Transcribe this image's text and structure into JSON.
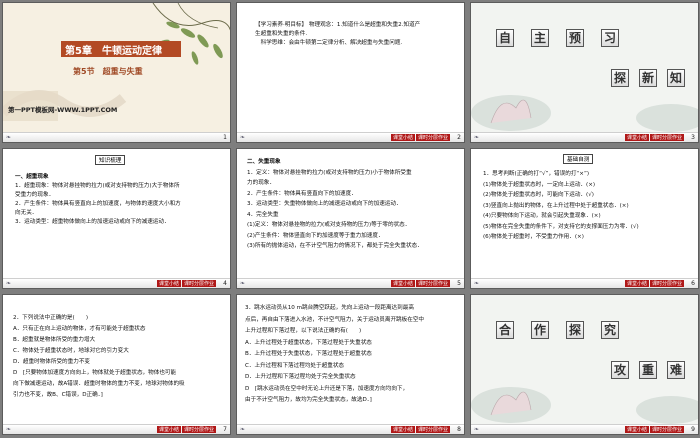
{
  "slides": [
    {
      "num": "1",
      "chapter": "第5章　牛顿运动定律",
      "section": "第5节　超重与失重",
      "site": "第一PPT模板网-WWW.1PPT.COM"
    },
    {
      "num": "2",
      "lines": [
        "【学习素养·明目标】 物理观念：1.知道什么是超重和失重2.知道产",
        "生超重和失重的条件.",
        "　科学思维：会由牛顿第二定律分析、解决超重与失重问题."
      ]
    },
    {
      "num": "3",
      "chars1": [
        "自",
        "主",
        "预",
        "习"
      ],
      "chars2": [
        "探",
        "新",
        "知"
      ]
    },
    {
      "num": "4",
      "heading": "知识梳理",
      "lines": [
        "一、超重现象",
        "1．超重现象：物体对悬挂物的拉力(或对支持物的压力)大于物体所",
        "受重力的现象．",
        "2．产生条件：物体具有竖直向上的加速度，与物体的速度大小和方",
        "向无关．",
        "3．运动类型：超重物体做向上的加速运动或向下的减速运动．"
      ]
    },
    {
      "num": "5",
      "lines": [
        "二、失重现象",
        "1．定义：物体对悬挂物的拉力(或对支持物的压力)小于物体所受重",
        "力的现象．",
        "2．产生条件：物体具有竖直向下的加速度．",
        "3．运动类型：失重物体做向上的减速运动或向下的加速运动．",
        "4．完全失重",
        "(1)定义：物体对悬挂物的拉力(或对支持物的压力)等于零的状态．",
        "(2)产生条件：物体竖直向下的加速度等于重力加速度．",
        "(3)所有的抛体运动，在不计空气阻力的情况下，都处于完全失重状态．"
      ]
    },
    {
      "num": "6",
      "heading": "基础自测",
      "lines": [
        "1．思考判断(正确的打“√”，错误的打“×”)",
        "(1)物体处于超重状态时，一定向上运动．(×)",
        "(2)物体处于超重状态时，可能向下运动．(√)",
        "(3)竖直向上抛出的物体，在上升过程中处于超重状态．(×)",
        "(4)只要物体向下运动，就会引起失重现象．(×)",
        "(5)物体在完全失重的条件下，对支持它的支撑面压力为零．(√)",
        "(6)物体处于超重时，不受重力作用．(×)"
      ]
    },
    {
      "num": "7",
      "lines": [
        "2．下列说法中正确的是(　　)",
        "A．只有正在向上运动的物体，才有可能处于超重状态",
        "B．超重就是物体所受的重力增大",
        "C．物体处于超重状态时，地球对它的引力变大",
        "D．超重时物体所受的重力不变",
        "D　[只要物体加速度方向向上，物体就处于超重状态，物体也可能",
        "向下做减速运动，故A错误．超重时物体的重力不变，地球对物体的吸",
        "引力也不变，故B、C错误，D正确．]"
      ]
    },
    {
      "num": "8",
      "lines": [
        "3．跳水运动员从10 m跳台腾空跃起，先向上运动一段距离达到最高",
        "点后，再自由下落进入水池，不计空气阻力，关于运动员离开跳板在空中",
        "上升过程和下落过程，以下说法正确的有(　　)",
        "A．上升过程处于超重状态，下落过程处于失重状态",
        "B．上升过程处于失重状态，下落过程处于超重状态",
        "C．上升过程和下落过程均处于超重状态",
        "D．上升过程和下落过程均处于完全失重状态",
        "D　[跳水运动员在空中时无论上升还是下落，加速度方向均向下，",
        "由于不计空气阻力，故均为完全失重状态，故选D．]"
      ]
    },
    {
      "num": "9",
      "chars1": [
        "合",
        "作",
        "探",
        "究"
      ],
      "chars2": [
        "攻",
        "重",
        "难"
      ]
    }
  ],
  "footer_nav": [
    "返回",
    "课堂小结",
    "课时分层作业"
  ],
  "footer_leaf": "❧"
}
